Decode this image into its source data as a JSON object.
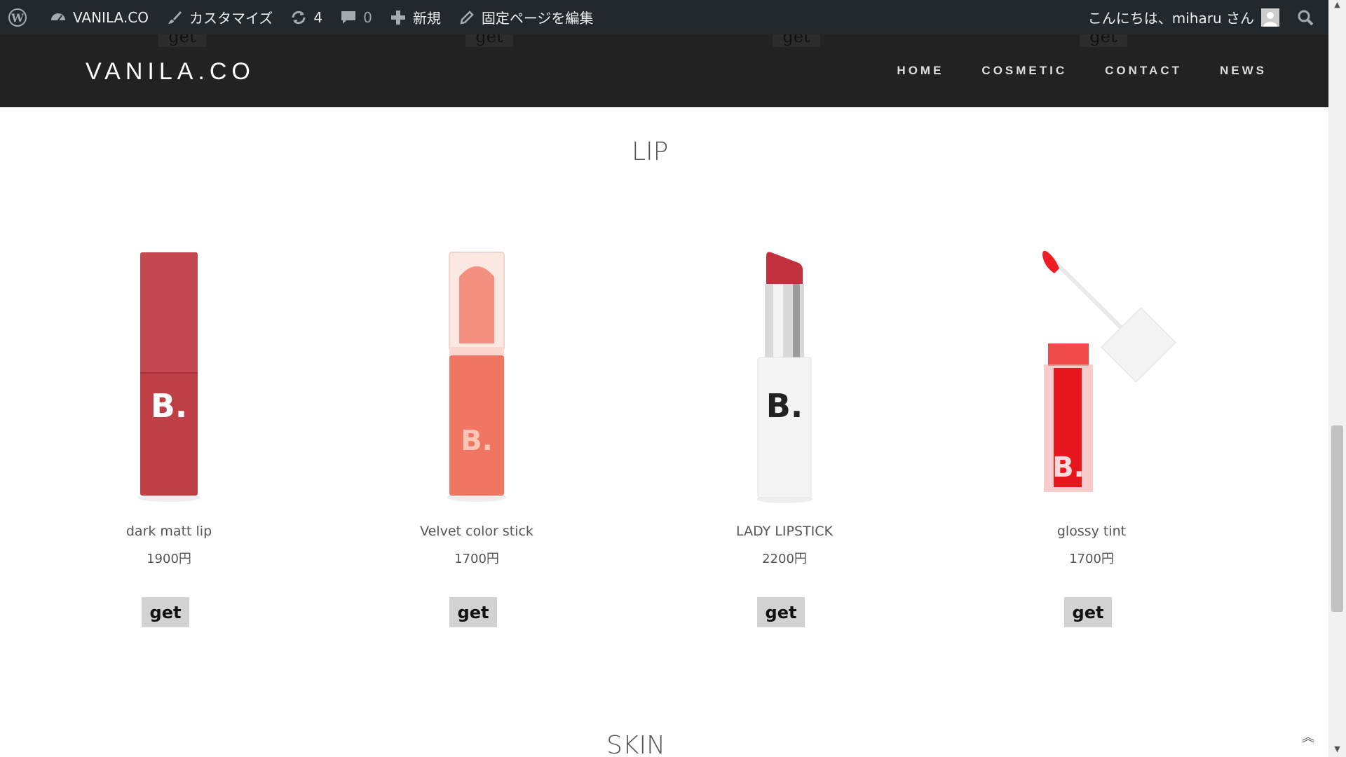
{
  "adminbar": {
    "site_name": "VANILA.CO",
    "customize": "カスタマイズ",
    "updates_count": "4",
    "comments_count": "0",
    "new_label": "新規",
    "edit_label": "固定ページを編集",
    "greeting": "こんにちは、miharu さん"
  },
  "header": {
    "logo": "VANILA.CO",
    "nav": [
      "HOME",
      "COSMETIC",
      "CONTACT",
      "NEWS"
    ],
    "ghost_button": "get"
  },
  "sections": {
    "lip_title": "LIP",
    "skin_title": "SKIN"
  },
  "products": [
    {
      "name": "dark matt lip",
      "price": "1900円",
      "button": "get"
    },
    {
      "name": "Velvet color stick",
      "price": "1700円",
      "button": "get"
    },
    {
      "name": "LADY LIPSTICK",
      "price": "2200円",
      "button": "get"
    },
    {
      "name": "glossy tint",
      "price": "1700円",
      "button": "get"
    }
  ],
  "product_brand_mark": "B.",
  "colors": {
    "adminbar_bg": "#23282d",
    "header_bg": "#222222",
    "button_bg": "#d2d2d2",
    "title_highlight": "#fde2ea"
  }
}
